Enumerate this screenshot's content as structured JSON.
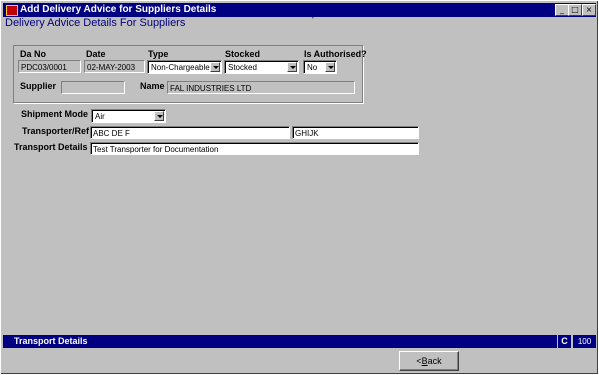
{
  "window": {
    "title": "Add Delivery Advice for Suppliers Details",
    "minimize": "_",
    "maximize": "□",
    "close": "×"
  },
  "heading": "Delivery Advice Details For Suppliers",
  "heading_mark": "'",
  "form": {
    "da_no_label": "Da No",
    "da_no_value": "PDC03/0001",
    "date_label": "Date",
    "date_value": "02-MAY-2003",
    "type_label": "Type",
    "type_value": "Non-Chargeable",
    "stocked_label": "Stocked",
    "stocked_value": "Stocked",
    "authorised_label": "Is Authorised?",
    "authorised_value": "No",
    "supplier_label": "Supplier",
    "supplier_value": "",
    "name_label": "Name",
    "name_value": "FAL INDUSTRIES LTD",
    "shipment_mode_label": "Shipment Mode",
    "shipment_mode_value": "Air",
    "transporter_ref_label": "Transporter/Ref",
    "transporter_value": "ABC DE F",
    "ref_value": "GHIJK",
    "transport_details_label": "Transport Details",
    "transport_details_value": "Test Transporter for Documentation"
  },
  "status": {
    "text": "Transport Details",
    "mode": "C",
    "value": "100"
  },
  "buttons": {
    "back_prefix": "<",
    "back_label": "Back"
  }
}
